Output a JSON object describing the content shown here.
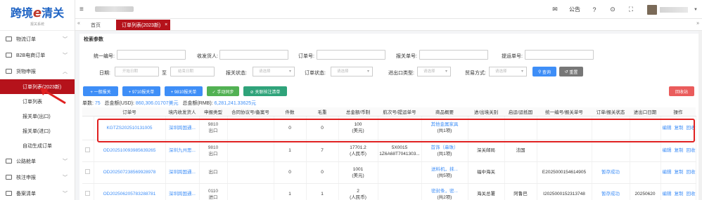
{
  "logo": {
    "main_a": "跨境",
    "e": "e",
    "main_b": "清关",
    "sub": "报关系统"
  },
  "sidebar": {
    "items": [
      {
        "label": "物流订单",
        "chevron": "﹀"
      },
      {
        "label": "B2B电商订单",
        "chevron": "﹀"
      },
      {
        "label": "货物申报",
        "chevron": "︿"
      }
    ],
    "sub_items": [
      {
        "label": "订单列表(2023新)",
        "active": true
      },
      {
        "label": "订单列表"
      },
      {
        "label": "报关单(出口)"
      },
      {
        "label": "报关单(进口)"
      },
      {
        "label": "自动生成订单"
      }
    ],
    "bottom_items": [
      {
        "label": "公路舱单",
        "chevron": "﹀"
      },
      {
        "label": "核注申报",
        "chevron": "﹀"
      },
      {
        "label": "备案清单",
        "chevron": "﹀"
      }
    ]
  },
  "topbar": {
    "hamburger": "≡",
    "notice": "公告",
    "icons": [
      "✉",
      "?",
      "⊙",
      "⛶"
    ],
    "caret": "▼"
  },
  "tabs": {
    "prev": "«",
    "home": "首页",
    "active": "订单列表(2023新)",
    "close": "×",
    "next": "»"
  },
  "search": {
    "title": "检索参数",
    "labels": {
      "unified_no": "统一编号:",
      "consignee": "收发货人:",
      "order_no": "订单号:",
      "declaration_no": "报关单号:",
      "bill_no": "提运单号:",
      "date": "日期:",
      "to": "至",
      "decl_status": "报关状态:",
      "order_status": "订单状态:",
      "ie_type": "进出口类型:",
      "trade_mode": "贸易方式:"
    },
    "placeholders": {
      "start_date": "开始日期",
      "end_date": "结束日期",
      "select": "请选择"
    },
    "query_btn": "查询",
    "reset_btn": "重置"
  },
  "actions": {
    "general_declaration": "+ 一般报关",
    "declare_9710": "+ 9710报关单",
    "declare_9810": "+ 9810报关单",
    "manual_sync": "✓ 手动同步",
    "link_consignment": "⊘ 关联核注清单",
    "recycle_bin": "回收站"
  },
  "summary": {
    "count_label": "单数:",
    "count": "75",
    "usd_label": "总金额(USD):",
    "usd": "860,306.01707美元",
    "rmb_label": "总金额(RMB):",
    "rmb": "6,281,241.33625元"
  },
  "table": {
    "headers": [
      "",
      "订单号",
      "境内收发货人",
      "申报类型",
      "合同协议号/备案号",
      "件数",
      "毛重",
      "总金额/币制",
      "航次号/提运单号",
      "商品概要",
      "进/出境关别",
      "启运/运抵国",
      "统一编号/报关单号",
      "订单/报关状态",
      "进出口日期",
      "操作"
    ],
    "rows": [
      {
        "order_no": "KGTZS202510131005",
        "consignee": "深圳跨国通...",
        "type_code": "9810",
        "type_dir": "出口",
        "contract": "",
        "pieces": "0",
        "gross_weight": "0",
        "amount": "100",
        "currency": "(美元)",
        "voyage": "",
        "bill": "",
        "goods": "其他金属家具",
        "goods_count": "(共1项)",
        "port": "",
        "country": "",
        "unified_no": "",
        "status": "",
        "date": "",
        "ops": [
          "编辑",
          "复制",
          "回收"
        ],
        "checkbox": false
      },
      {
        "order_no": "OD202510093985639265",
        "consignee": "深圳九州思...",
        "type_code": "9810",
        "type_dir": "出口",
        "contract": "",
        "pieces": "1",
        "gross_weight": "7",
        "amount": "17701.2",
        "currency": "(人民币)",
        "voyage": "5X0015",
        "bill": "1Z6A68T7041303...",
        "goods": "首饰（串珠）",
        "goods_count": "(共1项)",
        "port": "深关邮局",
        "country": "法国",
        "unified_no": "",
        "status": "",
        "date": "",
        "ops": [
          "编辑",
          "复制",
          "回收"
        ],
        "checkbox": true
      },
      {
        "order_no": "OD202507238569928978",
        "consignee": "深圳跨国通...",
        "type_code": "",
        "type_dir": "出口",
        "contract": "",
        "pieces": "0",
        "gross_weight": "0",
        "amount": "1001",
        "currency": "(美元)",
        "voyage": "",
        "bill": "",
        "goods": "送料机，抹...",
        "goods_count": "(共5项)",
        "port": "福中海关",
        "country": "",
        "unified_no": "E2025000154614905",
        "status": "暂存成功",
        "date": "",
        "ops": [
          "编辑",
          "复制",
          "回收"
        ],
        "checkbox": true
      },
      {
        "order_no": "OD202506205783288781",
        "consignee": "深圳跨国通...",
        "type_code": "0110",
        "type_dir": "进口",
        "contract": "",
        "pieces": "1",
        "gross_weight": "1",
        "amount": "2",
        "currency": "(人民币)",
        "voyage": "",
        "bill": "",
        "goods": "密封条，密...",
        "goods_count": "(共2项)",
        "port": "海关总署",
        "country": "阿鲁巴",
        "unified_no": "I2025000152313748",
        "status": "暂存成功",
        "date": "20250620",
        "ops": [
          "编辑",
          "复制",
          "回收"
        ],
        "checkbox": true
      }
    ]
  },
  "colors": {
    "brand_red": "#b5121b",
    "link_blue": "#3e8ef7",
    "highlight": "#e02020"
  }
}
